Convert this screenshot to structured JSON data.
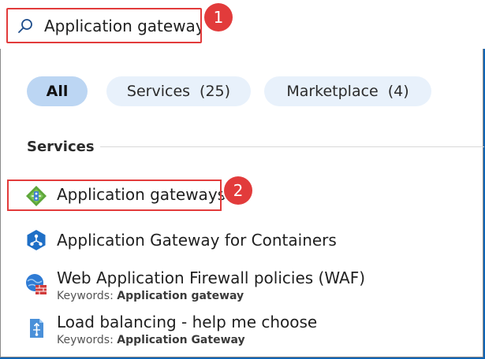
{
  "search": {
    "value": "Application gateways",
    "placeholder": ""
  },
  "callouts": [
    "1",
    "2"
  ],
  "filters": [
    {
      "label": "All",
      "count": ""
    },
    {
      "label": "Services",
      "count": "(25)"
    },
    {
      "label": "Marketplace",
      "count": "(4)"
    }
  ],
  "section_title": "Services",
  "results": [
    {
      "title": "Application gateways",
      "keywords_label": "",
      "keywords_value": "",
      "icon": "application-gateway-icon"
    },
    {
      "title": "Application Gateway for Containers",
      "keywords_label": "",
      "keywords_value": "",
      "icon": "gateway-containers-icon"
    },
    {
      "title": "Web Application Firewall policies (WAF)",
      "keywords_label": "Keywords:",
      "keywords_value": "Application gateway",
      "icon": "waf-policy-icon"
    },
    {
      "title": "Load balancing - help me choose",
      "keywords_label": "Keywords:",
      "keywords_value": "Application Gateway",
      "icon": "load-balancing-icon"
    }
  ],
  "colors": {
    "accent": "#0f64b4",
    "callout": "#e23b3b",
    "pill_bg": "#e8f1fb",
    "pill_active": "#bcd6f3"
  }
}
